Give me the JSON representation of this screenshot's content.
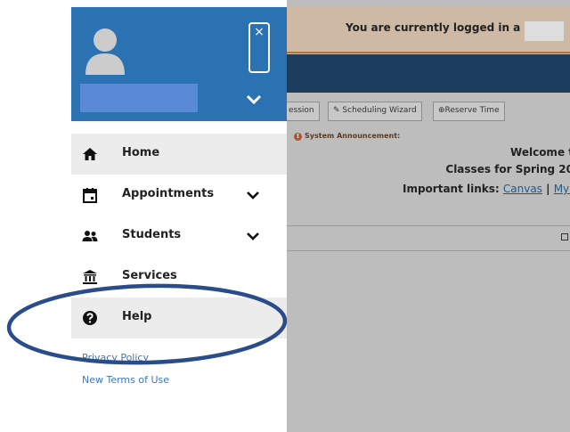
{
  "background_page": {
    "banner_text": "You are currently logged in a",
    "toolbar": {
      "session_label": "ession",
      "scheduling_wizard_label": "Scheduling Wizard",
      "reserve_time_label": "Reserve Time"
    },
    "announcement_label": "System Announcement:",
    "welcome_text": "Welcome t",
    "classes_text": "Classes for Spring 20",
    "important_links_label": "Important links:",
    "canvas_link": "Canvas",
    "separator": "|",
    "myn_link": "MyN"
  },
  "drawer": {
    "header": {
      "close_icon_glyph": "×",
      "user_name": ""
    },
    "nav": [
      {
        "label": "Home",
        "icon": "home-icon",
        "shaded": true,
        "expandable": false
      },
      {
        "label": "Appointments",
        "icon": "calendar-icon",
        "shaded": false,
        "expandable": true
      },
      {
        "label": "Students",
        "icon": "people-icon",
        "shaded": false,
        "expandable": true
      },
      {
        "label": "Services",
        "icon": "institution-icon",
        "shaded": false,
        "expandable": false
      },
      {
        "label": "Help",
        "icon": "question-circle-icon",
        "shaded": true,
        "expandable": false
      }
    ],
    "footer_links": {
      "privacy": "Privacy Policy",
      "terms": "New Terms of Use"
    }
  },
  "colors": {
    "drawer_header": "#2b72b2",
    "nav_shaded": "#ececec",
    "link": "#3b78b5",
    "annotation_ellipse": "#2a4d8a",
    "overlay_page": "#bdbdbd"
  }
}
